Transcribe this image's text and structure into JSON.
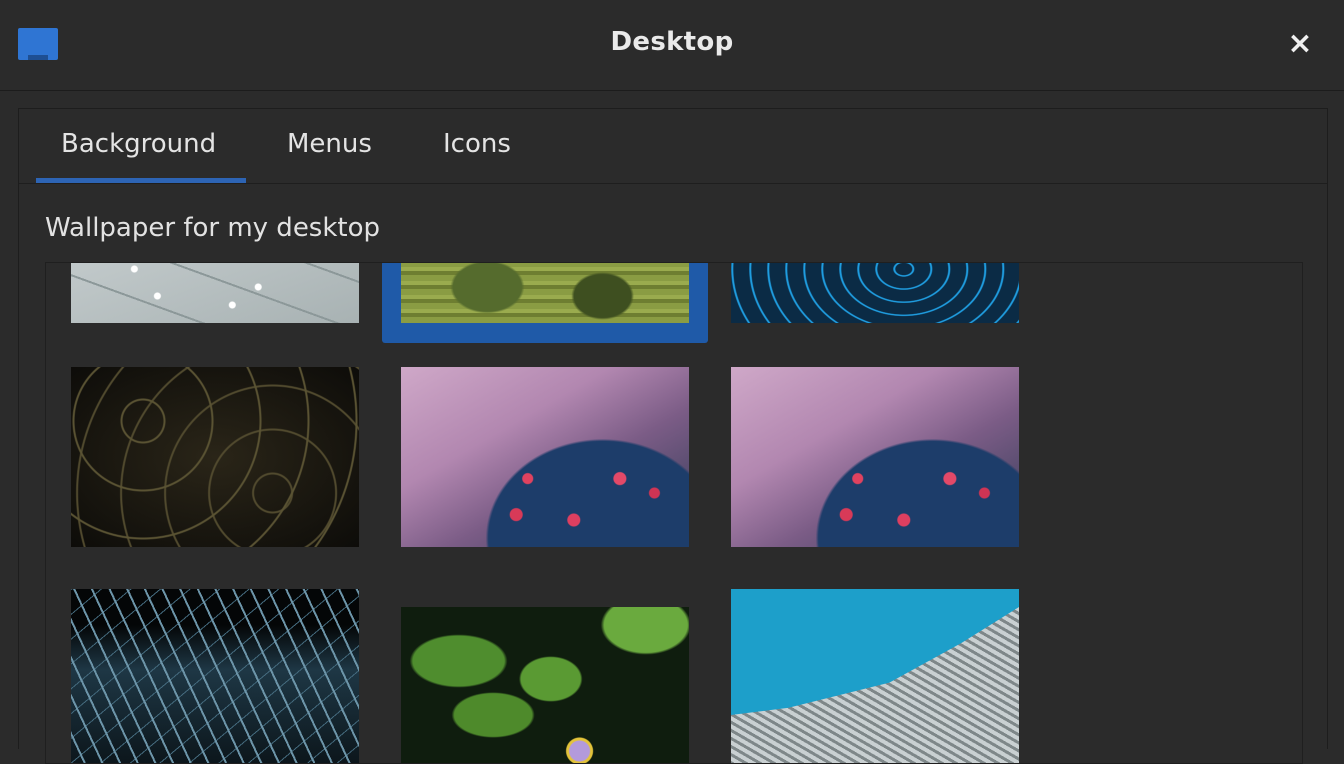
{
  "window": {
    "title": "Desktop",
    "close_label": "×",
    "app_icon": "desktop-icon"
  },
  "tabs": [
    {
      "label": "Background",
      "active": true
    },
    {
      "label": "Menus",
      "active": false
    },
    {
      "label": "Icons",
      "active": false
    }
  ],
  "background": {
    "section_label": "Wallpaper for my desktop",
    "selected_index": 1,
    "wallpapers": [
      {
        "name": "ceiling-lights"
      },
      {
        "name": "green-moss"
      },
      {
        "name": "blue-swirl"
      },
      {
        "name": "dark-floral-pattern"
      },
      {
        "name": "pink-flowers"
      },
      {
        "name": "pink-flowers"
      },
      {
        "name": "ice-crystals"
      },
      {
        "name": "water-lily"
      },
      {
        "name": "curved-building"
      }
    ]
  },
  "colors": {
    "accent": "#2d64b4",
    "background": "#2b2b2b",
    "text": "#e6e6e6"
  }
}
